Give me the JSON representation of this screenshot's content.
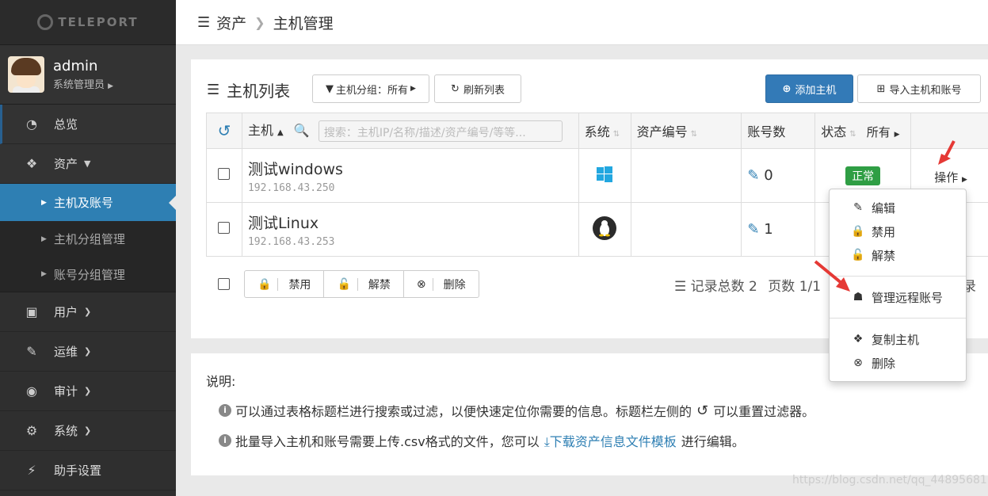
{
  "sidebar": {
    "logo_text": "TELEPORT",
    "user": {
      "name": "admin",
      "role": "系统管理员"
    },
    "items": [
      {
        "label": "总览",
        "icon": "dashboard-icon"
      },
      {
        "label": "资产",
        "icon": "cubes-icon"
      },
      {
        "label": "主机及账号"
      },
      {
        "label": "主机分组管理"
      },
      {
        "label": "账号分组管理"
      },
      {
        "label": "用户",
        "icon": "address-book-icon"
      },
      {
        "label": "运维",
        "icon": "wrench-icon"
      },
      {
        "label": "审计",
        "icon": "eye-icon"
      },
      {
        "label": "系统",
        "icon": "gear-icon"
      },
      {
        "label": "助手设置",
        "icon": "bolt-icon"
      }
    ]
  },
  "breadcrumb": {
    "section": "资产",
    "page": "主机管理"
  },
  "panel": {
    "title": "主机列表",
    "group_filter_label": "主机分组：所有",
    "refresh_label": "刷新列表",
    "add_host_label": "添加主机",
    "import_label": "导入主机和账号"
  },
  "table": {
    "headers": {
      "host": "主机",
      "os": "系统",
      "asset_no": "资产编号",
      "accounts": "账号数",
      "status": "状态",
      "status_filter": "所有"
    },
    "search_placeholder": "搜索：主机IP/名称/描述/资产编号/等等...",
    "rows": [
      {
        "name": "测试windows",
        "ip": "192.168.43.250",
        "os": "windows",
        "asset_no": "",
        "accounts": "0",
        "status": "正常",
        "action": "操作"
      },
      {
        "name": "测试Linux",
        "ip": "192.168.43.253",
        "os": "linux",
        "asset_no": "",
        "accounts": "1"
      }
    ]
  },
  "bulk": {
    "disable": "禁用",
    "enable": "解禁",
    "delete": "删除"
  },
  "pager": {
    "total": "记录总数 2",
    "pages": "页数 1/1",
    "tail": "录"
  },
  "menu": {
    "items": [
      "编辑",
      "禁用",
      "解禁",
      "管理远程账号",
      "复制主机",
      "删除"
    ]
  },
  "notes": {
    "title": "说明:",
    "line1a": "可以通过表格标题栏进行搜索或过滤，以便快速定位你需要的信息。标题栏左侧的",
    "line1b": "可以重置过滤器。",
    "line2a": "批量导入主机和账号需要上传.csv格式的文件，您可以",
    "line2_link": "下载资产信息文件模板",
    "line2b": "进行编辑。"
  },
  "watermark": "https://blog.csdn.net/qq_44895681",
  "colors": {
    "primary": "#337ab7",
    "sidebar": "#2f2f2f",
    "selected": "#2e7fb3",
    "ok": "#2f9e44",
    "arrow": "#e53935"
  }
}
